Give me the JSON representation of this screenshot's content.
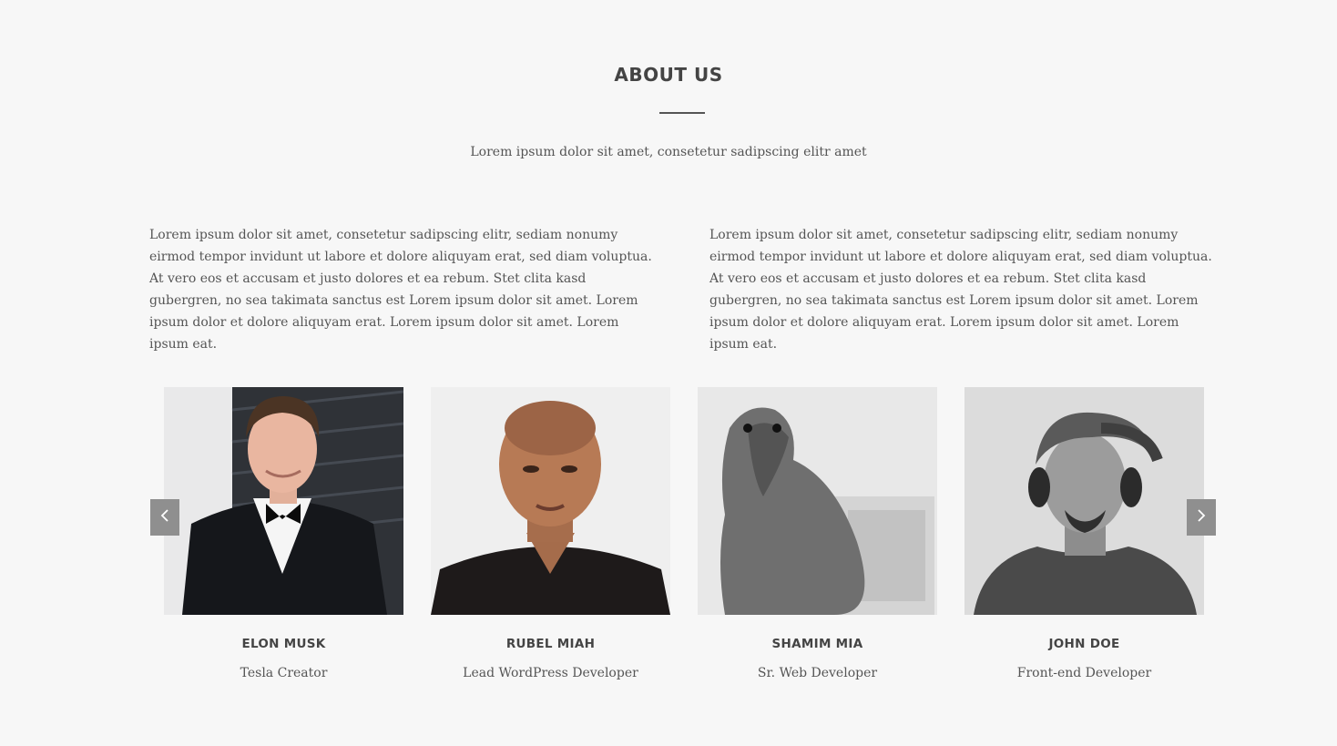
{
  "section": {
    "title": "ABOUT US",
    "subtitle": "Lorem ipsum dolor sit amet, consetetur sadipscing elitr amet",
    "paragraphs": [
      "Lorem ipsum dolor sit amet, consetetur sadipscing elitr, sediam nonumy eirmod tempor invidunt ut labore et dolore aliquyam erat, sed diam voluptua. At vero eos et accusam et justo dolores et ea rebum. Stet clita kasd gubergren, no sea takimata sanctus est Lorem ipsum dolor sit amet. Lorem ipsum dolor et dolore aliquyam erat. Lorem ipsum dolor sit amet. Lorem ipsum eat.",
      "Lorem ipsum dolor sit amet, consetetur sadipscing elitr, sediam nonumy eirmod tempor invidunt ut labore et dolore aliquyam erat, sed diam voluptua. At vero eos et accusam et justo dolores et ea rebum. Stet clita kasd gubergren, no sea takimata sanctus est Lorem ipsum dolor sit amet. Lorem ipsum dolor et dolore aliquyam erat. Lorem ipsum dolor sit amet. Lorem ipsum eat."
    ]
  },
  "team": [
    {
      "name": "ELON MUSK",
      "role": "Tesla Creator"
    },
    {
      "name": "RUBEL MIAH",
      "role": "Lead WordPress Developer"
    },
    {
      "name": "SHAMIM MIA",
      "role": "Sr. Web Developer"
    },
    {
      "name": "JOHN DOE",
      "role": "Front-end Developer"
    }
  ],
  "carousel": {
    "prev_icon": "chevron-left-icon",
    "next_icon": "chevron-right-icon"
  },
  "colors": {
    "background": "#f7f7f7",
    "text": "#555555",
    "heading": "#444444",
    "arrow_bg": "#8f8f8f"
  }
}
